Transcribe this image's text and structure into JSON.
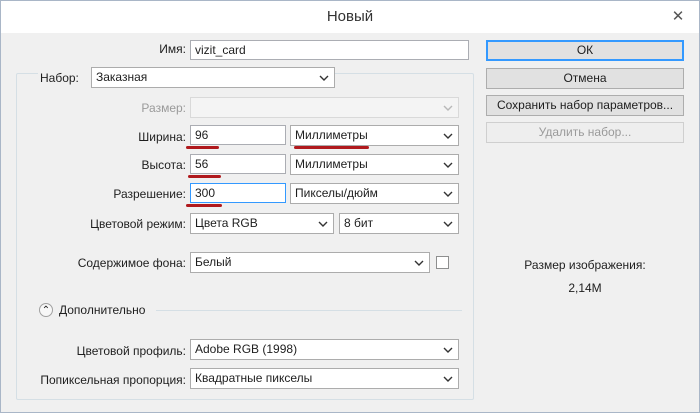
{
  "window": {
    "title": "Новый",
    "close_glyph": "✕"
  },
  "name": {
    "label": "Имя:",
    "value": "vizit_card"
  },
  "preset": {
    "label": "Набор:",
    "value": "Заказная"
  },
  "size": {
    "label": "Размер:",
    "value": ""
  },
  "width": {
    "label": "Ширина:",
    "value": "96",
    "unit": "Миллиметры"
  },
  "height": {
    "label": "Высота:",
    "value": "56",
    "unit": "Миллиметры"
  },
  "resolution": {
    "label": "Разрешение:",
    "value": "300",
    "unit": "Пикселы/дюйм"
  },
  "color_mode": {
    "label": "Цветовой режим:",
    "value": "Цвета RGB",
    "bits": "8 бит"
  },
  "background": {
    "label": "Содержимое фона:",
    "value": "Белый"
  },
  "advanced": {
    "label": "Дополнительно",
    "toggle_glyph": "⌃"
  },
  "color_profile": {
    "label": "Цветовой профиль:",
    "value": "Adobe RGB (1998)"
  },
  "pixel_aspect": {
    "label": "Попиксельная пропорция:",
    "value": "Квадратные пикселы"
  },
  "buttons": {
    "ok": "ОК",
    "cancel": "Отмена",
    "save_preset": "Сохранить набор параметров...",
    "delete_preset": "Удалить набор..."
  },
  "image_size": {
    "label": "Размер изображения:",
    "value": "2,14M"
  },
  "colors": {
    "annotation": "#b0191d",
    "focus": "#3399ff"
  }
}
